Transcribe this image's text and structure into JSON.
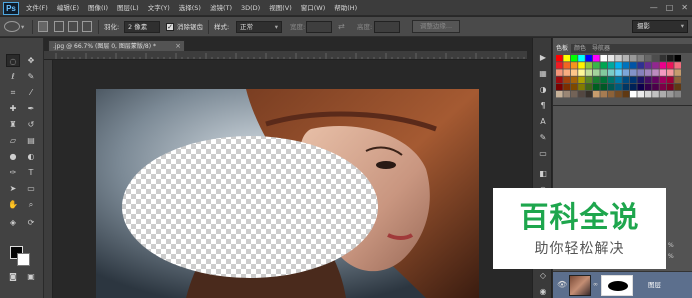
{
  "app": {
    "logo": "Ps",
    "menu": [
      "文件(F)",
      "编辑(E)",
      "图像(I)",
      "图层(L)",
      "文字(Y)",
      "选择(S)",
      "滤镜(T)",
      "3D(D)",
      "视图(V)",
      "窗口(W)",
      "帮助(H)"
    ],
    "window_controls": [
      "—",
      "□",
      "✕"
    ]
  },
  "options_bar": {
    "feather_label": "羽化:",
    "feather_value": "2 像素",
    "antialias_label": "消除锯齿",
    "antialias_checked": true,
    "style_label": "样式:",
    "style_value": "正常",
    "width_label": "宽度:",
    "height_label": "高度:",
    "refine_edge_button": "调整边缘...",
    "workspace_value": "摄影"
  },
  "document": {
    "tab_label": ".jpg @ 66.7% (图层 0, 图层蒙版/8) *",
    "close_icon": "×"
  },
  "panels": {
    "swatch_tabs": [
      "色板",
      "颜色",
      "导航器"
    ],
    "opacity_1": "%",
    "opacity_2": "%",
    "layer_name": "图层"
  },
  "watermark": {
    "title": "百科全说",
    "subtitle": "助你轻松解决",
    "title_color": "#1ea64d"
  },
  "colors": {
    "foreground": "#050505",
    "background": "#ffffff",
    "layer_selected": "#5c6f8d"
  }
}
